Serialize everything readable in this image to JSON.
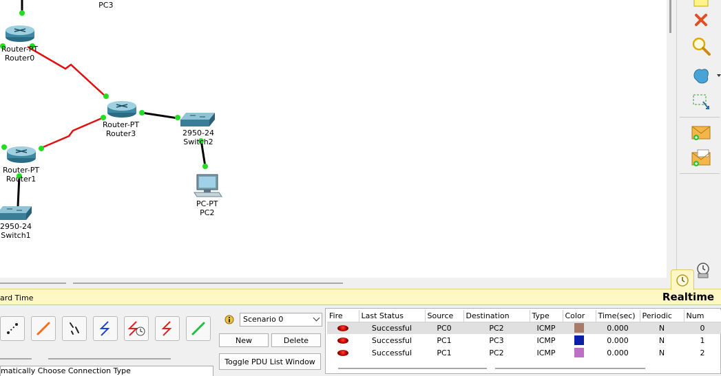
{
  "devices": {
    "pc3": {
      "type": "PC-PT",
      "name": "PC3"
    },
    "router0": {
      "type": "Router-PT",
      "name": "Router0"
    },
    "router3": {
      "type": "Router-PT",
      "name": "Router3"
    },
    "router1": {
      "type": "Router-PT",
      "name": "Router1"
    },
    "switch2": {
      "type": "2950-24",
      "name": "Switch2"
    },
    "switch1": {
      "type": "2950-24",
      "name": "Switch1"
    },
    "pc2": {
      "type": "PC-PT",
      "name": "PC2"
    }
  },
  "palette": {
    "tools": [
      "select-tool",
      "delete-icon",
      "inspect-icon",
      "draw-shape-icon",
      "resize-icon",
      "add-simple-pdu-icon",
      "add-complex-pdu-icon"
    ]
  },
  "modebar": {
    "left_text": "ard Time",
    "mode": "Realtime"
  },
  "connections": {
    "status_text": "matically Choose Connection Type",
    "types": [
      "automatic-connection",
      "console-cable",
      "copper-straight-through",
      "phone-cable",
      "serial-dce",
      "serial-dte",
      "octal-cable"
    ]
  },
  "scenario": {
    "selected": "Scenario 0",
    "new_label": "New",
    "delete_label": "Delete",
    "toggle_label": "Toggle PDU List Window"
  },
  "pdu_list": {
    "headers": [
      "Fire",
      "Last Status",
      "Source",
      "Destination",
      "Type",
      "Color",
      "Time(sec)",
      "Periodic",
      "Num"
    ],
    "rows": [
      {
        "status": "Successful",
        "source": "PC0",
        "destination": "PC2",
        "type": "ICMP",
        "color": "#a97a68",
        "time": "0.000",
        "periodic": "N",
        "num": "0"
      },
      {
        "status": "Successful",
        "source": "PC1",
        "destination": "PC3",
        "type": "ICMP",
        "color": "#0a1ea8",
        "time": "0.000",
        "periodic": "N",
        "num": "1"
      },
      {
        "status": "Successful",
        "source": "PC1",
        "destination": "PC2",
        "type": "ICMP",
        "color": "#bf6fc8",
        "time": "0.000",
        "periodic": "N",
        "num": "2"
      }
    ]
  }
}
